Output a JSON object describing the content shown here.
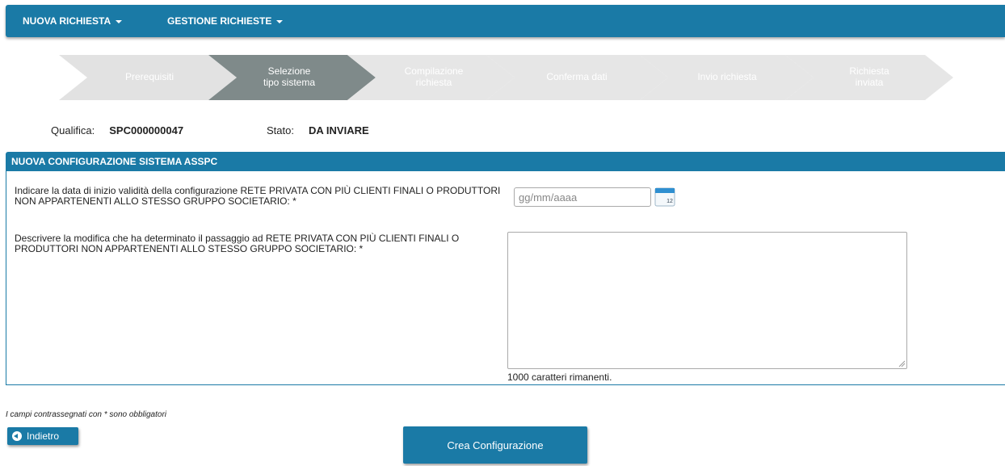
{
  "navbar": {
    "items": [
      {
        "label": "NUOVA RICHIESTA"
      },
      {
        "label": "GESTIONE RICHIESTE"
      }
    ]
  },
  "wizard": {
    "steps": [
      {
        "label": "Prerequisiti",
        "state": "done"
      },
      {
        "label": "Selezione\ntipo sistema",
        "state": "active"
      },
      {
        "label": "Compilazione\nrichiesta",
        "state": "todo"
      },
      {
        "label": "Conferma dati",
        "state": "todo"
      },
      {
        "label": "Invio richiesta",
        "state": "todo"
      },
      {
        "label": "Richiesta\ninviata",
        "state": "todo"
      }
    ]
  },
  "meta": {
    "qualifica_label": "Qualifica:",
    "qualifica_value": "SPC000000047",
    "stato_label": "Stato:",
    "stato_value": "DA INVIARE"
  },
  "section": {
    "title": "NUOVA CONFIGURAZIONE SISTEMA ASSPC",
    "date_label": "Indicare la data di inizio validità della configurazione RETE PRIVATA CON PIÙ CLIENTI FINALI O PRODUTTORI NON APPARTENENTI ALLO STESSO GRUPPO SOCIETARIO: *",
    "date_placeholder": "gg/mm/aaaa",
    "calendar_day": "12",
    "description_label": "Descrivere la modifica che ha determinato il passaggio ad RETE PRIVATA CON PIÙ CLIENTI FINALI O PRODUTTORI NON APPARTENENTI ALLO STESSO GRUPPO SOCIETARIO: *",
    "remaining_chars": "1000 caratteri rimanenti."
  },
  "footer": {
    "required_note": "I campi contrassegnati con * sono obbligatori",
    "back_label": "Indietro",
    "create_label": "Crea Configurazione"
  },
  "colors": {
    "primary": "#1a7aa6",
    "step_done": "#e2e2e2",
    "step_active": "#7f8a8a",
    "step_todo": "#e6e6e6"
  }
}
